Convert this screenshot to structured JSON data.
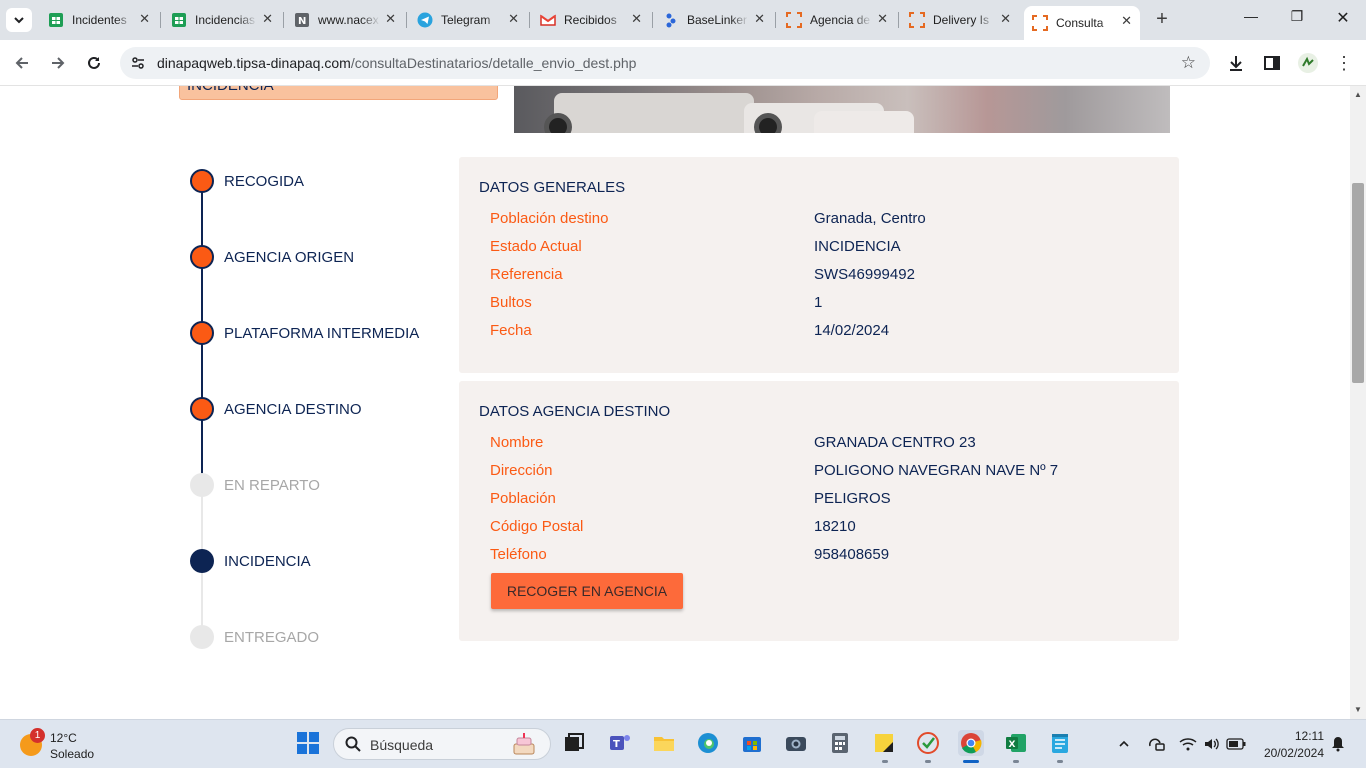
{
  "browser": {
    "tabs": [
      {
        "title": "Incidentes",
        "icon": "sheets-icon"
      },
      {
        "title": "Incidencias",
        "icon": "sheets-icon"
      },
      {
        "title": "www.nacex",
        "icon": "notion-icon"
      },
      {
        "title": "Telegram",
        "icon": "telegram-icon"
      },
      {
        "title": "Recibidos",
        "icon": "gmail-icon"
      },
      {
        "title": "BaseLinker",
        "icon": "baselinker-icon"
      },
      {
        "title": "Agencia de",
        "icon": "frame-icon"
      },
      {
        "title": "Delivery Is",
        "icon": "frame-icon"
      },
      {
        "title": "Consulta",
        "icon": "frame-icon",
        "active": true
      }
    ],
    "url_host": "dinapaqweb.tipsa-dinapaq.com",
    "url_path": "/consultaDestinatarios/detalle_envio_dest.php"
  },
  "page": {
    "status_pill": "INCIDENCIA",
    "timeline": [
      {
        "label": "RECOGIDA",
        "state": "done"
      },
      {
        "label": "AGENCIA ORIGEN",
        "state": "done"
      },
      {
        "label": "PLATAFORMA INTERMEDIA",
        "state": "done"
      },
      {
        "label": "AGENCIA DESTINO",
        "state": "done"
      },
      {
        "label": "EN REPARTO",
        "state": "pending"
      },
      {
        "label": "INCIDENCIA",
        "state": "current"
      },
      {
        "label": "ENTREGADO",
        "state": "pending"
      }
    ],
    "general": {
      "title": "DATOS GENERALES",
      "rows": [
        {
          "key": "Población destino",
          "value": "Granada, Centro"
        },
        {
          "key": "Estado Actual",
          "value": "INCIDENCIA"
        },
        {
          "key": "Referencia",
          "value": "SWS46999492"
        },
        {
          "key": "Bultos",
          "value": "1"
        },
        {
          "key": "Fecha",
          "value": "14/02/2024"
        }
      ]
    },
    "agency": {
      "title": "DATOS AGENCIA DESTINO",
      "rows": [
        {
          "key": "Nombre",
          "value": "GRANADA CENTRO 23"
        },
        {
          "key": "Dirección",
          "value": "POLIGONO NAVEGRAN NAVE Nº 7"
        },
        {
          "key": "Población",
          "value": "PELIGROS"
        },
        {
          "key": "Código Postal",
          "value": "18210"
        },
        {
          "key": "Teléfono",
          "value": "958408659"
        }
      ],
      "button_label": "RECOGER EN AGENCIA"
    }
  },
  "taskbar": {
    "weather_badge": "1",
    "weather_temp": "12°C",
    "weather_desc": "Soleado",
    "search_placeholder": "Búsqueda",
    "time": "12:11",
    "date": "20/02/2024"
  },
  "colors": {
    "brand_navy": "#0d2453",
    "brand_orange": "#fb5a14",
    "card_bg": "#f5f1ef",
    "button": "#fd6a3a"
  }
}
